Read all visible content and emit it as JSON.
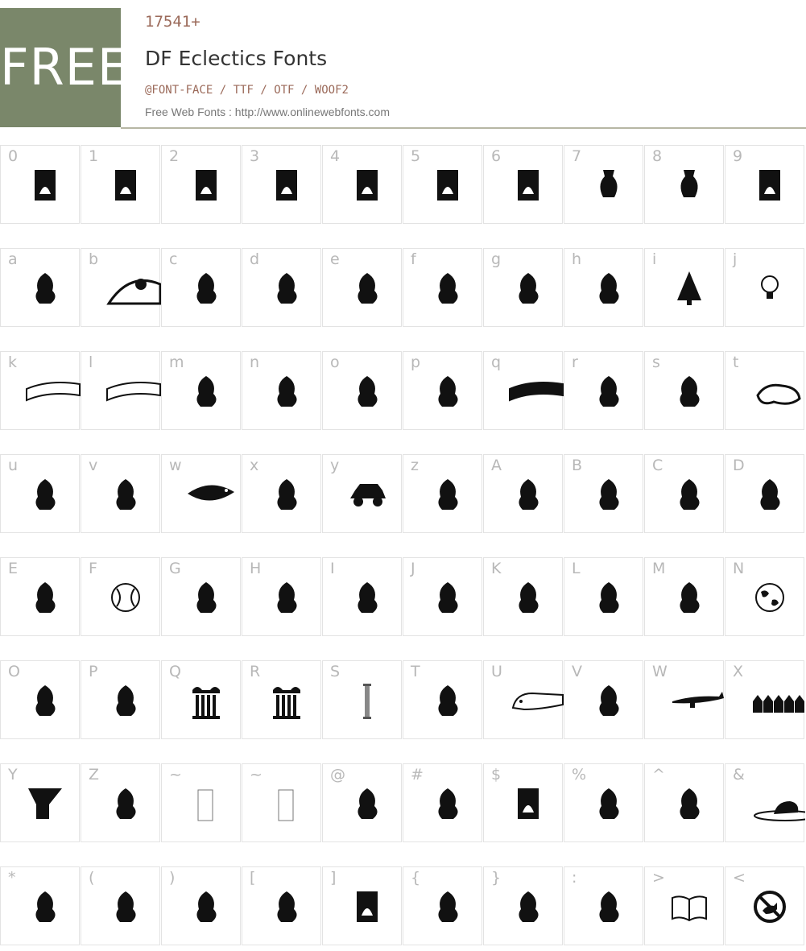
{
  "header": {
    "badge": "FREE",
    "count": "17541+",
    "title": "DF Eclectics Fonts",
    "formats": [
      "@FONT-FACE",
      "TTF",
      "OTF",
      "WOOF2"
    ],
    "separator": " / ",
    "source": "Free Web Fonts : http://www.onlinewebfonts.com"
  },
  "glyph_rows": [
    [
      "0",
      "1",
      "2",
      "3",
      "4",
      "5",
      "6",
      "7",
      "8",
      "9"
    ],
    [
      "a",
      "b",
      "c",
      "d",
      "e",
      "f",
      "g",
      "h",
      "i",
      "j"
    ],
    [
      "k",
      "l",
      "m",
      "n",
      "o",
      "p",
      "q",
      "r",
      "s",
      "t"
    ],
    [
      "u",
      "v",
      "w",
      "x",
      "y",
      "z",
      "A",
      "B",
      "C",
      "D"
    ],
    [
      "E",
      "F",
      "G",
      "H",
      "I",
      "J",
      "K",
      "L",
      "M",
      "N"
    ],
    [
      "O",
      "P",
      "Q",
      "R",
      "S",
      "T",
      "U",
      "V",
      "W",
      "X"
    ],
    [
      "Y",
      "Z",
      "~",
      "~",
      "@",
      "#",
      "$",
      "%",
      "^",
      "&"
    ],
    [
      "*",
      "(",
      ")",
      "[",
      "]",
      "{",
      "}",
      ":",
      ">",
      "<"
    ]
  ],
  "glyph_icons": [
    [
      "stamp-sun-icon",
      "night-tree-icon",
      "night-hands-icon",
      "mask-frame-icon",
      "house-tree-icon",
      "candle-icon",
      "ribbon-panel-icon",
      "vase-icon",
      "urn-faces-icon",
      "leaf-panel-icon"
    ],
    [
      "dancer-icon",
      "hill-sun-icon",
      "sailboat-icon",
      "bird-man-icon",
      "star-cloud-icon",
      "scissors-icon",
      "watering-can-icon",
      "house-icon",
      "christmas-tree-icon",
      "lightbulb-icon"
    ],
    [
      "art-banner-icon",
      "art-banner-icon",
      "city-icon",
      "leaves-icon",
      "sign-post-icon",
      "teapot-icon",
      "color-banner-icon",
      "sun-flower-icon",
      "grapes-icon",
      "face-profile-icon"
    ],
    [
      "strawberry-icon",
      "computer-icon",
      "fish-icon",
      "island-icon",
      "car-icon",
      "elephant-icon",
      "coffee-cup-icon",
      "shooting-star-icon",
      "thinker-icon",
      "hot-pepper-icon"
    ],
    [
      "woman-bust-icon",
      "baseball-icon",
      "cyclist-icon",
      "tree-icon",
      "family-icon",
      "star-runner-icon",
      "chair-man-icon",
      "cutlery-icon",
      "whale-icon",
      "globe-icon"
    ],
    [
      "angel-icon",
      "rabbit-icon",
      "column-icon",
      "column-icon",
      "pillar-icon",
      "tree-cloud-icon",
      "pig-icon",
      "rocket-icon",
      "airplane-icon",
      "village-icon"
    ],
    [
      "y-block-icon",
      "swimmer-icon",
      "empty-box-icon",
      "empty-box-icon",
      "gown-icon",
      "village-house-icon",
      "tree-panel-icon",
      "chick-icon",
      "juggler-icon",
      "hat-icon"
    ],
    [
      "dolphin-icon",
      "bikini-icon",
      "stars-bottle-icon",
      "castle-icon",
      "knight-icon",
      "sofa-icon",
      "tall-woman-icon",
      "cake-icon",
      "book-icon",
      "no-dog-icon"
    ]
  ],
  "colors": {
    "badge_bg": "#7a876a",
    "accent": "#9b6a5a",
    "cell_border": "#e3e3e3",
    "char_label": "#b8b8b8"
  }
}
